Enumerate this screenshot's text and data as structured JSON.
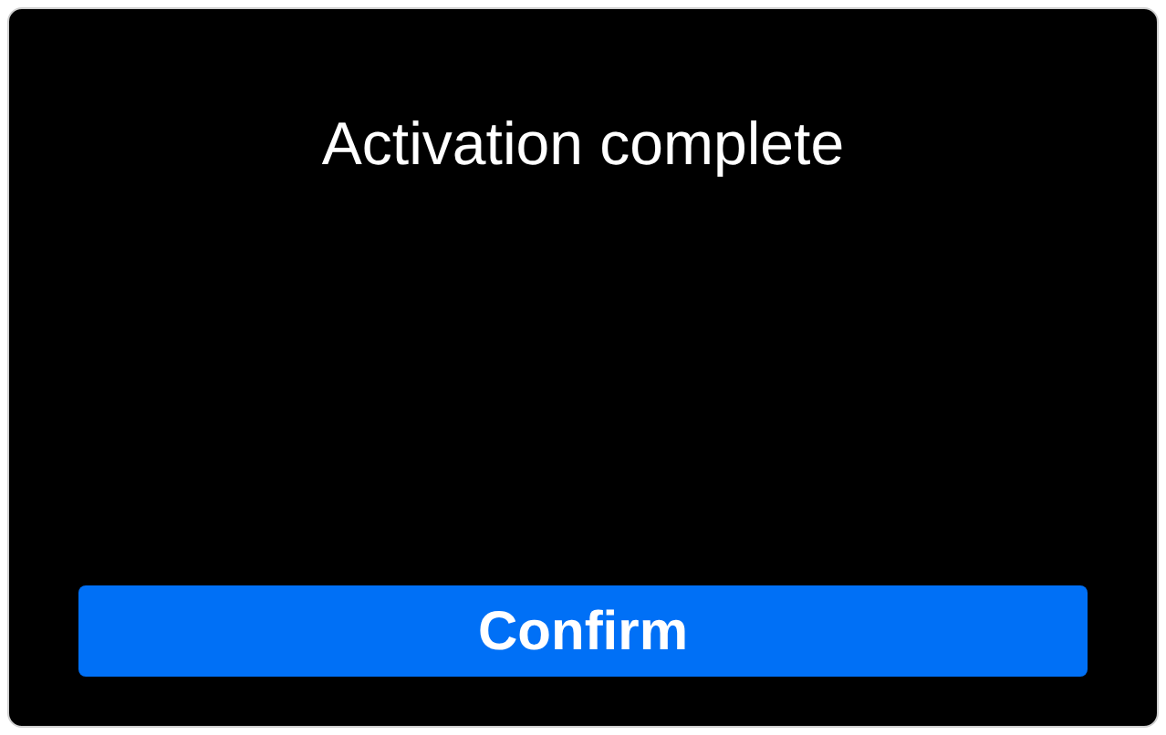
{
  "dialog": {
    "title": "Activation complete",
    "buttons": [
      {
        "label": "Confirm",
        "kind": "primary"
      }
    ]
  }
}
